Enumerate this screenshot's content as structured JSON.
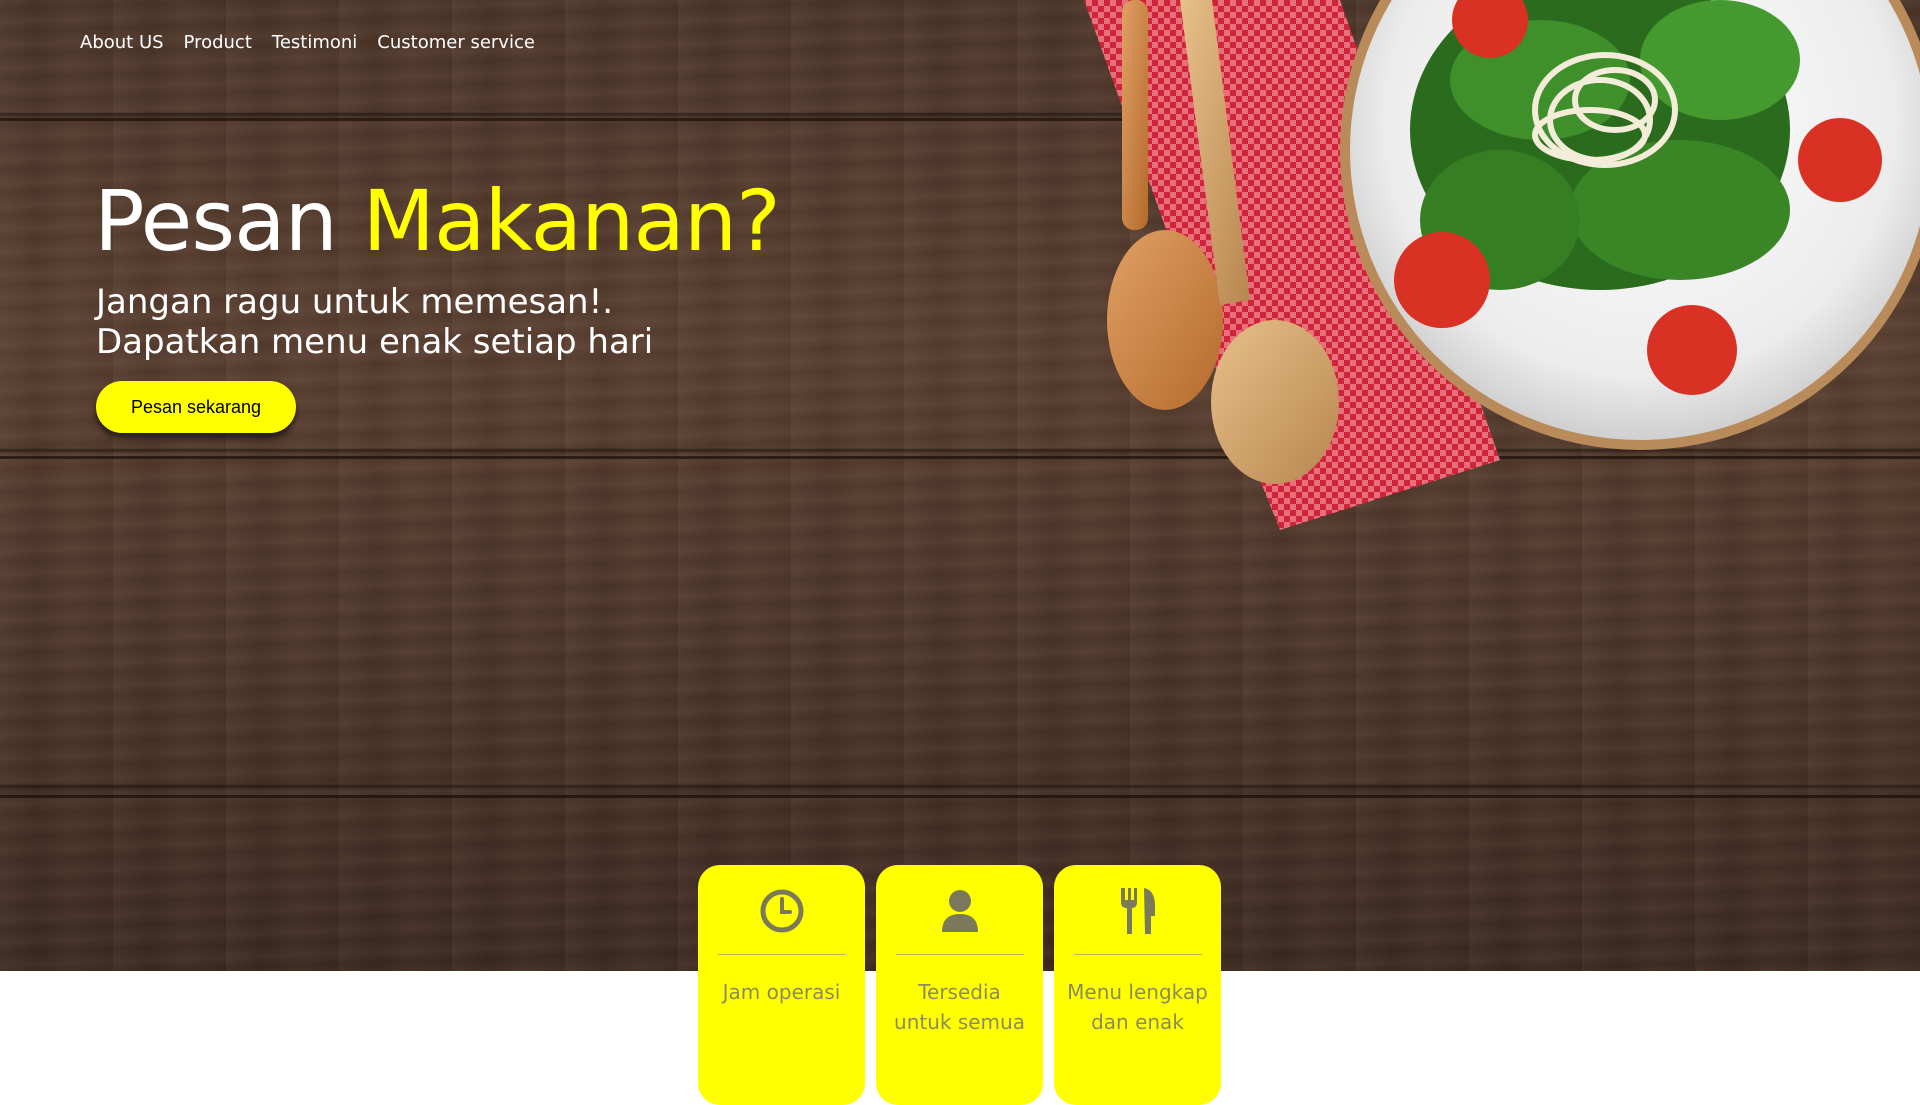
{
  "nav": {
    "items": [
      {
        "label": "About US"
      },
      {
        "label": "Product"
      },
      {
        "label": "Testimoni"
      },
      {
        "label": "Customer service"
      }
    ]
  },
  "hero": {
    "headline_main": "Pesan ",
    "headline_accent": "Makanan?",
    "subtitle_line1": "Jangan ragu untuk memesan!.",
    "subtitle_line2": "Dapatkan menu enak setiap hari",
    "cta_label": "Pesan sekarang",
    "image_icon": "salad-plate-with-wooden-spoons"
  },
  "features": [
    {
      "icon": "clock-icon",
      "label": "Jam operasi"
    },
    {
      "icon": "user-icon",
      "label": "Tersedia untuk semua"
    },
    {
      "icon": "utensils-icon",
      "label": "Menu lengkap dan enak"
    }
  ],
  "colors": {
    "accent": "#ffff00",
    "hero_text": "#ffffff",
    "feature_text": "#8c8c5a",
    "wood": "#4e3629"
  }
}
